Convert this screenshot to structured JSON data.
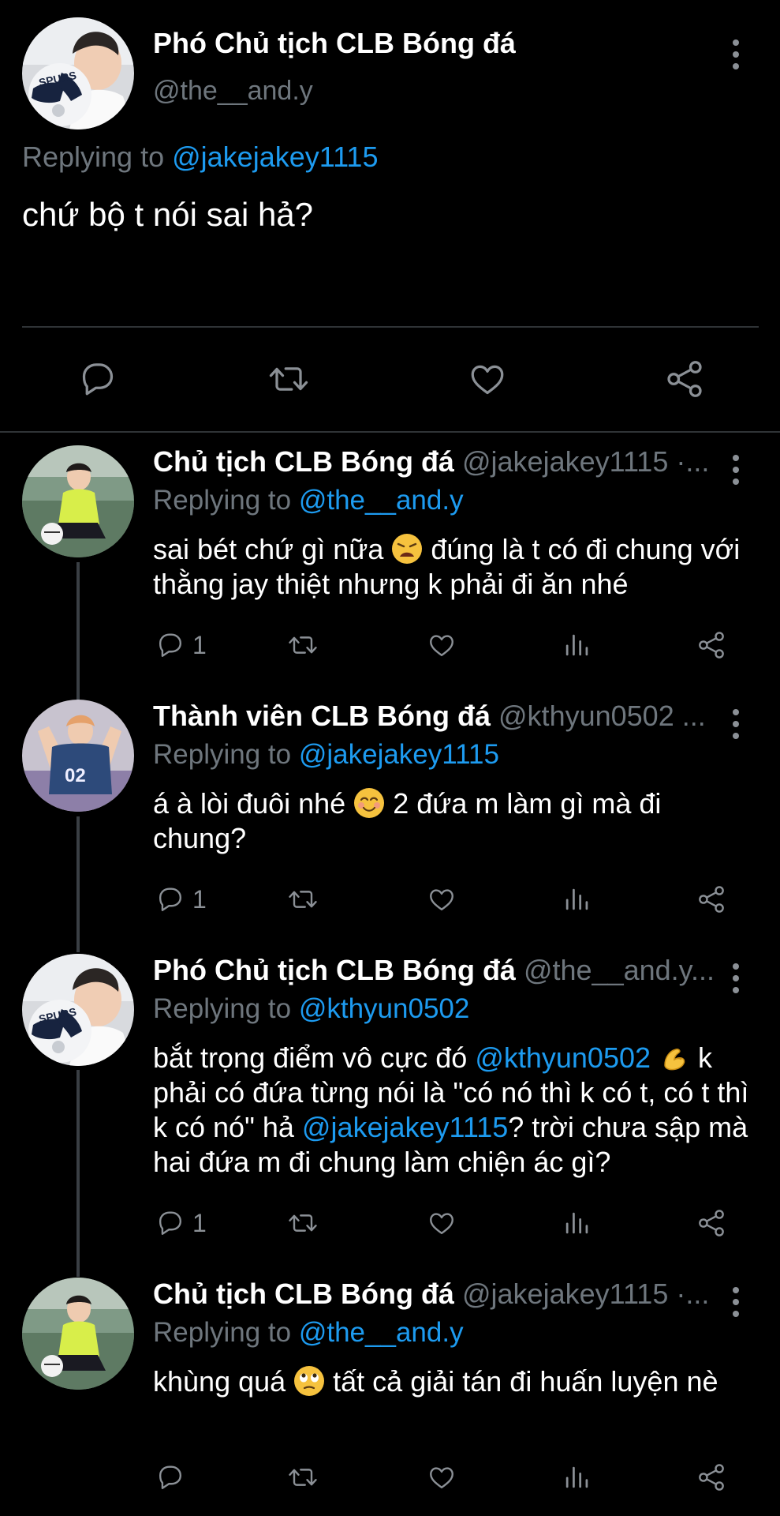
{
  "main_tweet": {
    "name": "Phó Chủ tịch CLB Bóng đá",
    "handle": "@the__and.y",
    "replying_prefix": "Replying to ",
    "replying_handle": "@jakejakey1115",
    "text": "chứ bộ t nói sai hả?"
  },
  "replies": [
    {
      "name": "Chủ tịch CLB Bóng đá",
      "handle": "@jakejakey1115 ·...",
      "replying_prefix": "Replying to ",
      "replying_handle": "@the__and.y",
      "text_a": "sai bét chứ gì nữa ",
      "emoji": "weary-face",
      "text_b": " đúng là t có đi chung với thằng jay thiệt nhưng k phải đi ăn nhé",
      "reply_count": "1"
    },
    {
      "name": "Thành viên CLB Bóng đá",
      "handle": "@kthyun0502 ...",
      "replying_prefix": "Replying to ",
      "replying_handle": "@jakejakey1115",
      "text_a": "á à lòi đuôi nhé ",
      "emoji": "smiling-face",
      "text_b": " 2 đứa m làm gì mà đi chung?",
      "reply_count": "1"
    },
    {
      "name": "Phó Chủ tịch CLB Bóng đá",
      "handle": "@the__and.y...",
      "replying_prefix": "Replying to ",
      "replying_handle": "@kthyun0502",
      "text_a": "bắt trọng điểm vô cực đó ",
      "mention_1": "@kthyun0502",
      "emoji": "pinching-hand",
      "text_b": " k phải có đứa từng nói là \"có nó thì k có t, có t thì k có nó\" hả ",
      "mention_2": "@jakejakey1115",
      "text_c": "? trời chưa sập mà hai đứa m đi chung làm chiện ác gì?",
      "reply_count": "1"
    },
    {
      "name": "Chủ tịch CLB Bóng đá",
      "handle": "@jakejakey1115 ·...",
      "replying_prefix": "Replying to ",
      "replying_handle": "@the__and.y",
      "text_a": "khùng quá ",
      "emoji": "eye-roll-face",
      "text_b": " tất cả giải tán đi huấn luyện nè",
      "reply_count": ""
    }
  ],
  "colors": {
    "background": "#000000",
    "text": "#ffffff",
    "secondary": "#6e767d",
    "link": "#1d9bf0",
    "divider": "#2f3336"
  }
}
